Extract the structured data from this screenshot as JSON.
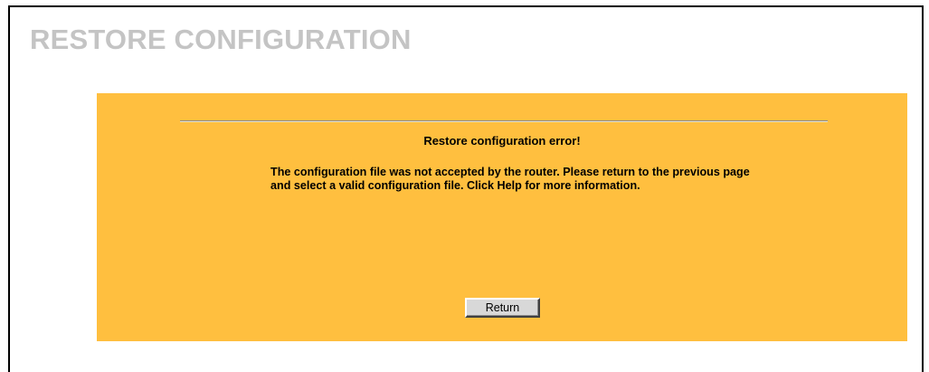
{
  "page": {
    "title": "RESTORE CONFIGURATION"
  },
  "panel": {
    "heading": "Restore configuration error!",
    "message": "The configuration file was not accepted by the router. Please return to the previous page and select a valid configuration file. Click Help for more information.",
    "return_label": "Return",
    "background_color": "#ffbf3f"
  },
  "colors": {
    "title": "#c4c4c4",
    "text": "#000000",
    "button_face": "#d8d8d8"
  }
}
